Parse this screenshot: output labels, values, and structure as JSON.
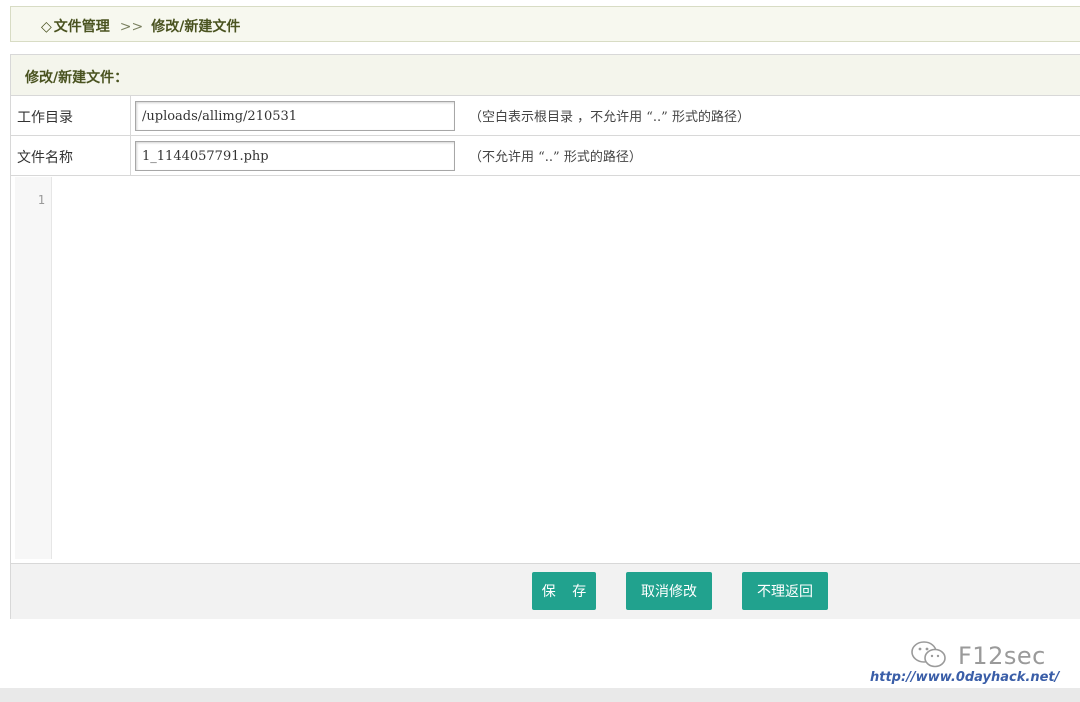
{
  "breadcrumb": {
    "diamond": "◇",
    "root": "文件管理",
    "separator": ">>",
    "current": "修改/新建文件"
  },
  "panel": {
    "title": "修改/新建文件："
  },
  "form": {
    "directory": {
      "label": "工作目录",
      "value": "/uploads/allimg/210531",
      "hint": "（空白表示根目录 ，不允许用 “..” 形式的路径）"
    },
    "filename": {
      "label": "文件名称",
      "value": "1_1144057791.php",
      "hint": "（不允许用 “..” 形式的路径）"
    }
  },
  "editor": {
    "line_number": "1",
    "content": ""
  },
  "buttons": {
    "save": "保 存",
    "cancel": "取消修改",
    "back": "不理返回"
  },
  "watermark": {
    "name": "F12sec",
    "url": "http://www.0dayhack.net/"
  },
  "colors": {
    "button": "#21a28e",
    "header_bg": "#f4f5ec",
    "breadcrumb_text": "#4a5320"
  }
}
